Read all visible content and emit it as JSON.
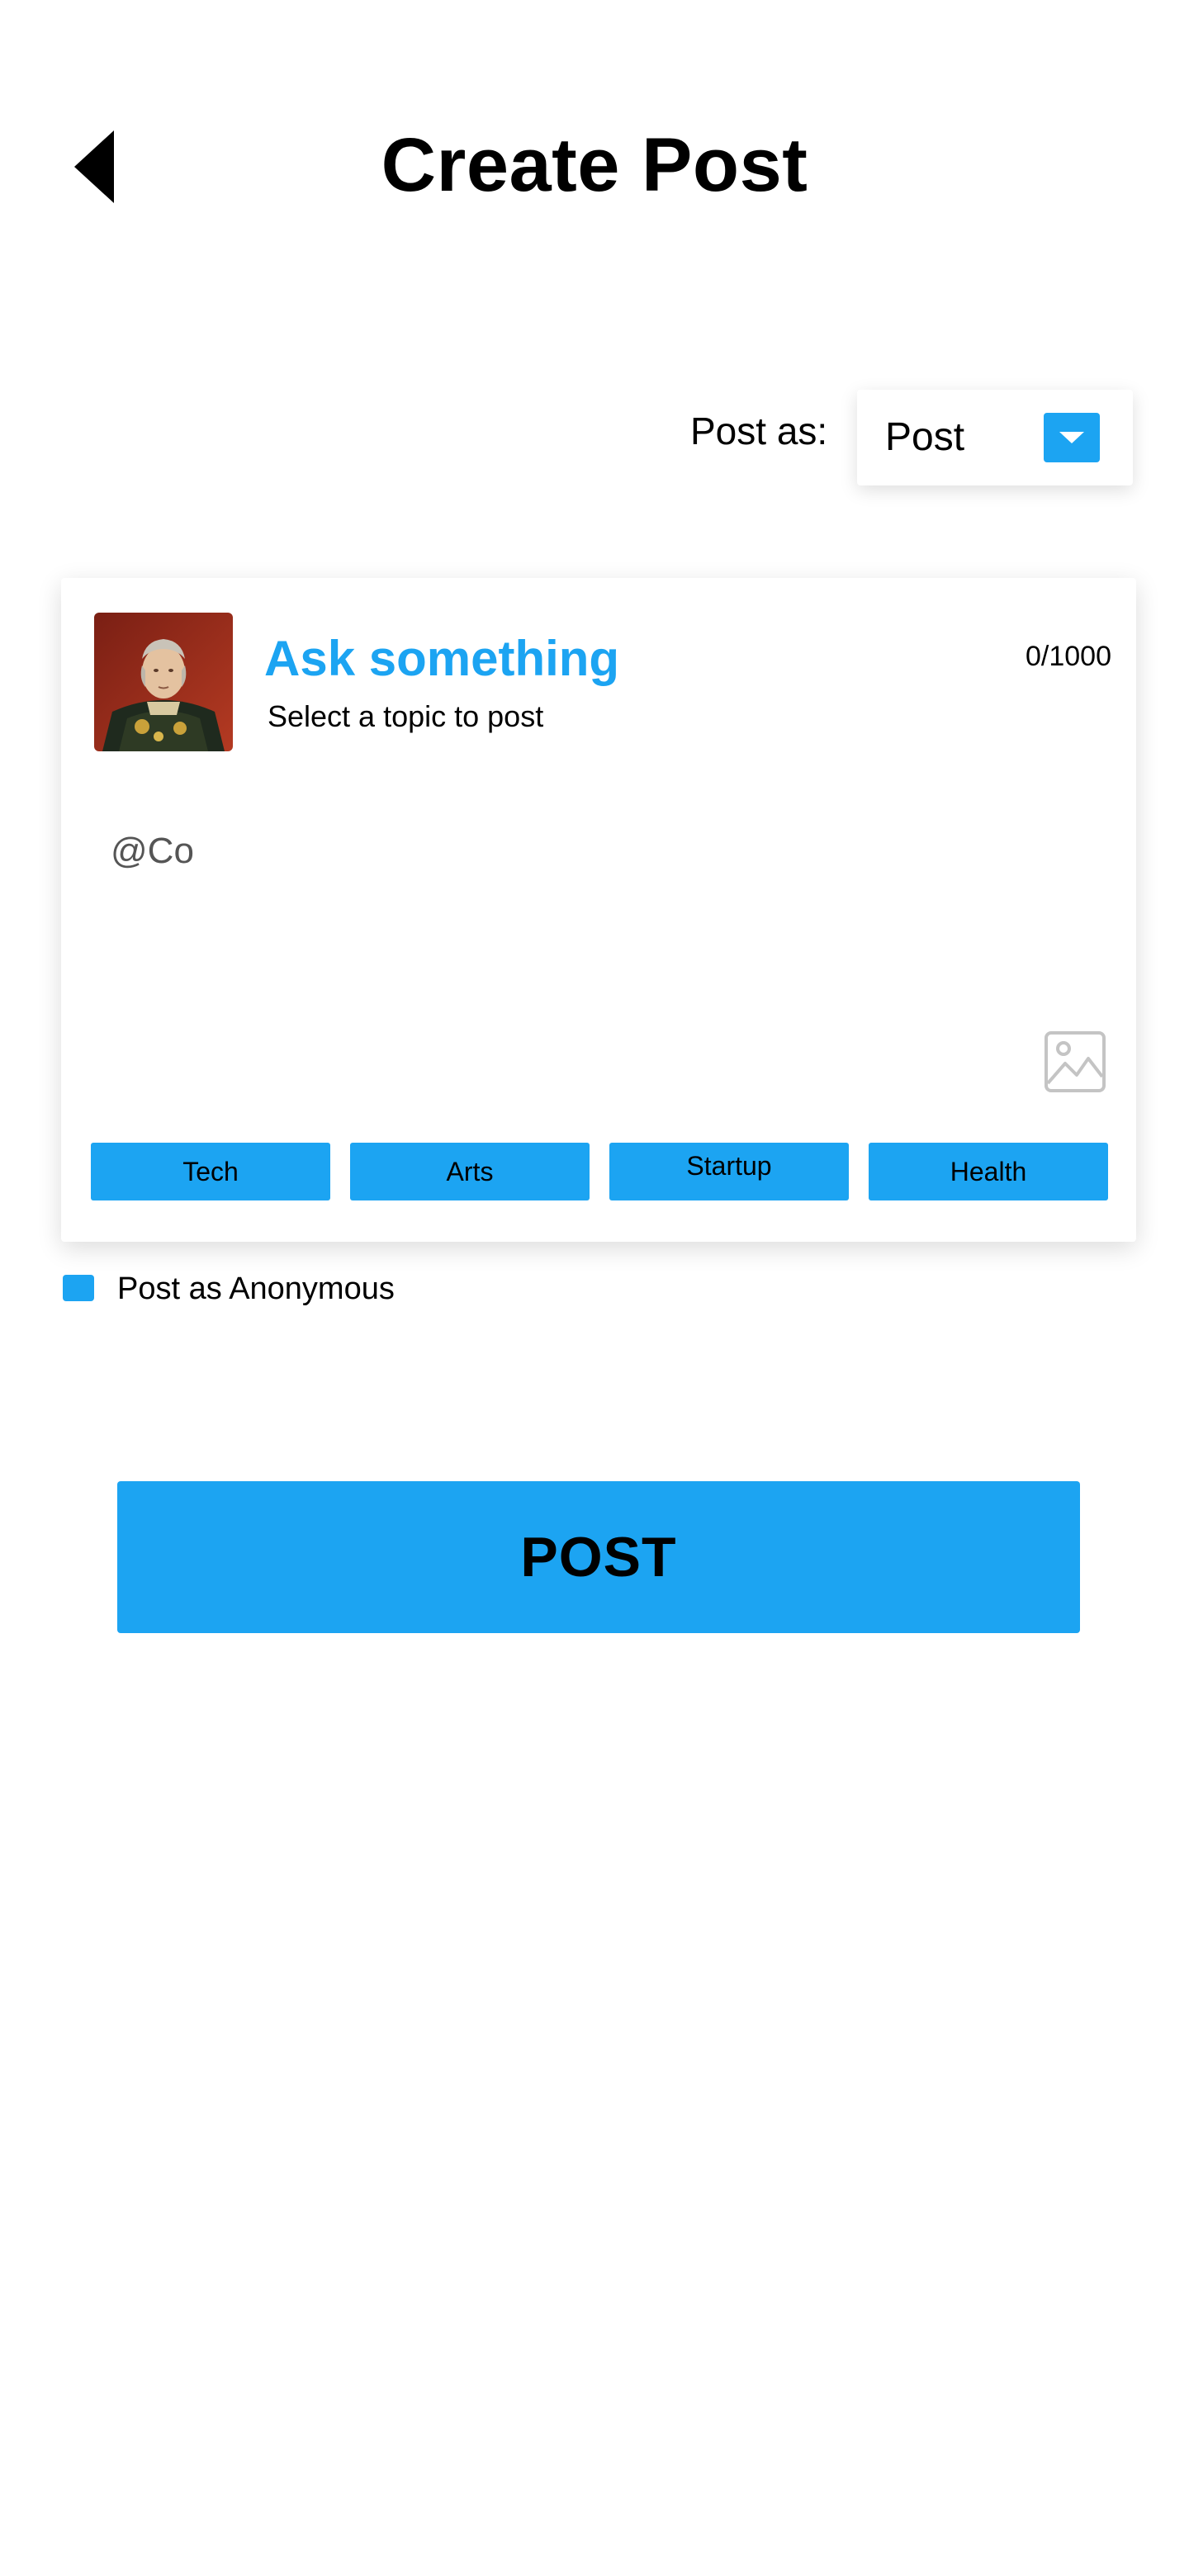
{
  "header": {
    "title": "Create Post",
    "back_icon": "back-triangle-icon"
  },
  "post_as": {
    "label": "Post as:",
    "selected": "Post",
    "dropdown_icon": "chevron-down-icon"
  },
  "card": {
    "title": "Ask something",
    "subtitle": "Select a topic to post",
    "counter": "0/1000",
    "text_value": "@Co",
    "image_icon": "image-icon",
    "topics": [
      "Tech",
      "Arts",
      "Startup",
      "Health"
    ]
  },
  "anonymous": {
    "label": "Post as Anonymous",
    "checked": true
  },
  "submit": {
    "label": "POST"
  },
  "colors": {
    "accent": "#1ca4f2",
    "text": "#000000",
    "background": "#ffffff"
  }
}
